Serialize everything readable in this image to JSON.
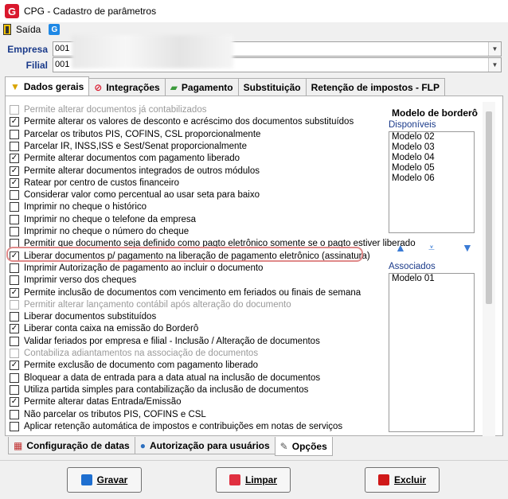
{
  "window": {
    "title": "CPG - Cadastro de parâmetros"
  },
  "toolbar": {
    "exit_label": "Saída"
  },
  "fields": {
    "empresa_label": "Empresa",
    "empresa_value": "001",
    "filial_label": "Filial",
    "filial_value": "001"
  },
  "tabs_top": [
    {
      "label": "Dados gerais",
      "icon": "funnel-icon",
      "active": true
    },
    {
      "label": "Integrações",
      "icon": "integration-icon",
      "active": false
    },
    {
      "label": "Pagamento",
      "icon": "money-icon",
      "active": false
    },
    {
      "label": "Substituição",
      "icon": "",
      "active": false
    },
    {
      "label": "Retenção de impostos - FLP",
      "icon": "",
      "active": false
    }
  ],
  "options": [
    {
      "label": "Permite alterar documentos já contabilizados",
      "checked": false,
      "disabled": true
    },
    {
      "label": "Permite alterar os valores de desconto e acréscimo dos documentos substituídos",
      "checked": true,
      "disabled": false
    },
    {
      "label": "Parcelar os tributos PIS, COFINS, CSL proporcionalmente",
      "checked": false,
      "disabled": false
    },
    {
      "label": "Parcelar IR, INSS,ISS e Sest/Senat proporcionalmente",
      "checked": false,
      "disabled": false
    },
    {
      "label": "Permite alterar documentos com pagamento liberado",
      "checked": true,
      "disabled": false
    },
    {
      "label": "Permite alterar documentos integrados de outros módulos",
      "checked": true,
      "disabled": false
    },
    {
      "label": "Ratear por centro de custos financeiro",
      "checked": true,
      "disabled": false
    },
    {
      "label": "Considerar valor como percentual ao usar seta para baixo",
      "checked": false,
      "disabled": false
    },
    {
      "label": "Imprimir no cheque o histórico",
      "checked": false,
      "disabled": false
    },
    {
      "label": "Imprimir no cheque o telefone da empresa",
      "checked": false,
      "disabled": false
    },
    {
      "label": "Imprimir no cheque o número do cheque",
      "checked": false,
      "disabled": false
    },
    {
      "label": "Permitir que documento seja definido como pagto eletrônico somente se o pagto estiver liberado",
      "checked": false,
      "disabled": false
    },
    {
      "label": "Liberar documentos p/ pagamento na liberação de pagamento eletrônico (assinatura)",
      "checked": true,
      "disabled": false
    },
    {
      "label": "Imprimir Autorização de pagamento ao incluir o documento",
      "checked": false,
      "disabled": false
    },
    {
      "label": "Imprimir verso dos cheques",
      "checked": false,
      "disabled": false
    },
    {
      "label": "Permite inclusão de documentos com vencimento em feriados ou finais de semana",
      "checked": true,
      "disabled": false
    },
    {
      "label": "Permitir alterar lançamento contábil após alteração do documento",
      "checked": false,
      "disabled": true
    },
    {
      "label": "Liberar documentos substituídos",
      "checked": false,
      "disabled": false
    },
    {
      "label": "Liberar conta caixa na emissão do Borderô",
      "checked": true,
      "disabled": false
    },
    {
      "label": "Validar feriados por empresa e filial - Inclusão / Alteração de documentos",
      "checked": false,
      "disabled": false
    },
    {
      "label": "Contabiliza adiantamentos na associação de documentos",
      "checked": false,
      "disabled": true
    },
    {
      "label": "Permite exclusão de documento com pagamento liberado",
      "checked": true,
      "disabled": false
    },
    {
      "label": "Bloquear a data de entrada para a data atual na inclusão de documentos",
      "checked": false,
      "disabled": false
    },
    {
      "label": "Utiliza partida simples para contabilização da inclusão de documentos",
      "checked": false,
      "disabled": false
    },
    {
      "label": "Permite alterar datas Entrada/Emissão",
      "checked": true,
      "disabled": false
    },
    {
      "label": "Não parcelar os tributos PIS, COFINS e CSL",
      "checked": false,
      "disabled": false
    },
    {
      "label": "Aplicar retenção automática de impostos e contribuições em notas de serviços",
      "checked": false,
      "disabled": false
    }
  ],
  "modelo": {
    "title": "Modelo de borderô",
    "disponiveis_label": "Disponíveis",
    "disponiveis": [
      "Modelo 02",
      "Modelo 03",
      "Modelo 04",
      "Modelo 05",
      "Modelo 06"
    ],
    "associados_label": "Associados",
    "associados": [
      "Modelo 01"
    ]
  },
  "tabs_bottom": [
    {
      "label": "Configuração de datas",
      "icon": "calendar-icon",
      "active": false
    },
    {
      "label": "Autorização para usuários",
      "icon": "user-icon",
      "active": false
    },
    {
      "label": "Opções",
      "icon": "wrench-icon",
      "active": true
    }
  ],
  "buttons": {
    "gravar": "Gravar",
    "limpar": "Limpar",
    "excluir": "Excluir"
  },
  "colors": {
    "accent": "#1a3a8a",
    "highlight": "#e08a8a"
  }
}
